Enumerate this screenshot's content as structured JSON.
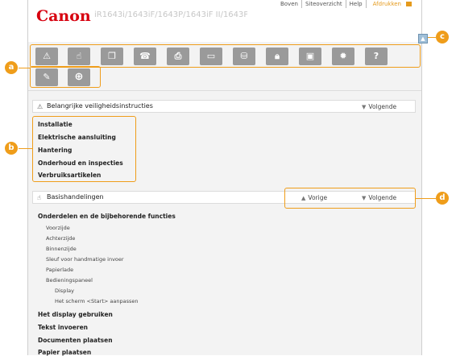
{
  "header": {
    "logo": "Canon",
    "product": "iR1643i/1643iF/1643P/1643iF II/1643P II",
    "links": [
      "Boven",
      "Siteoverzicht",
      "Help",
      "Afdrukken"
    ]
  },
  "callouts": {
    "a": "a",
    "b": "b",
    "c": "c",
    "d": "d"
  },
  "colors": {
    "accent": "#ef9d1a",
    "brand": "#d7000f",
    "icon_bg": "#9a9a9a"
  },
  "iconbar": {
    "row1": [
      "warning-icon",
      "hand-icon",
      "document-copy-icon",
      "fax-icon",
      "printer-icon",
      "scanner-icon",
      "network-icon",
      "lock-icon",
      "remote-ui-icon",
      "settings-gear-icon",
      "help-icon"
    ],
    "row2": [
      "wrench-icon",
      "plus-icon"
    ]
  },
  "scroll_top_icon": "scroll-top-icon",
  "section1": {
    "title": "Belangrijke veiligheidsinstructies",
    "next": "Volgende",
    "items": [
      "Installatie",
      "Elektrische aansluiting",
      "Hantering",
      "Onderhoud en inspecties",
      "Verbruiksartikelen"
    ]
  },
  "section2": {
    "title": "Basishandelingen",
    "prev": "Vorige",
    "next": "Volgende",
    "items": [
      {
        "text": "Onderdelen en de bijbehorende functies",
        "level": 0
      },
      {
        "text": "Voorzijde",
        "level": 1
      },
      {
        "text": "Achterzijde",
        "level": 1
      },
      {
        "text": "Binnenzijde",
        "level": 1
      },
      {
        "text": "Sleuf voor handmatige invoer",
        "level": 1
      },
      {
        "text": "Papierlade",
        "level": 1
      },
      {
        "text": "Bedieningspaneel",
        "level": 1
      },
      {
        "text": "Display",
        "level": 2
      },
      {
        "text": "Het scherm <Start> aanpassen",
        "level": 2
      },
      {
        "text": "Het display gebruiken",
        "level": 0
      },
      {
        "text": "Tekst invoeren",
        "level": 0
      },
      {
        "text": "Documenten plaatsen",
        "level": 0
      },
      {
        "text": "Papier plaatsen",
        "level": 0
      }
    ]
  }
}
